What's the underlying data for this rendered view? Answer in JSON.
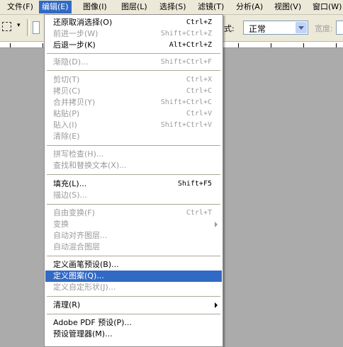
{
  "menubar": {
    "items": [
      {
        "label": "文件(F)"
      },
      {
        "label": "编辑(E)"
      },
      {
        "label": "图像(I)"
      },
      {
        "label": "图层(L)"
      },
      {
        "label": "选择(S)"
      },
      {
        "label": "滤镜(T)"
      },
      {
        "label": "分析(A)"
      },
      {
        "label": "视图(V)"
      },
      {
        "label": "窗口(W)"
      }
    ],
    "active_index": 1
  },
  "options_bar": {
    "style_label": "式:",
    "mode_value": "正常",
    "width_label": "宽度:"
  },
  "edit_menu": {
    "items": [
      {
        "label": "还原取消选择(O)",
        "shortcut": "Ctrl+Z",
        "enabled": true
      },
      {
        "label": "前进一步(W)",
        "shortcut": "Shift+Ctrl+Z",
        "enabled": false
      },
      {
        "label": "后退一步(K)",
        "shortcut": "Alt+Ctrl+Z",
        "enabled": true
      },
      {
        "label": "渐隐(D)...",
        "shortcut": "Shift+Ctrl+F",
        "enabled": false
      },
      {
        "label": "剪切(T)",
        "shortcut": "Ctrl+X",
        "enabled": false
      },
      {
        "label": "拷贝(C)",
        "shortcut": "Ctrl+C",
        "enabled": false
      },
      {
        "label": "合并拷贝(Y)",
        "shortcut": "Shift+Ctrl+C",
        "enabled": false
      },
      {
        "label": "粘贴(P)",
        "shortcut": "Ctrl+V",
        "enabled": false
      },
      {
        "label": "贴入(I)",
        "shortcut": "Shift+Ctrl+V",
        "enabled": false
      },
      {
        "label": "清除(E)",
        "shortcut": "",
        "enabled": false
      },
      {
        "label": "拼写检查(H)...",
        "shortcut": "",
        "enabled": false
      },
      {
        "label": "查找和替换文本(X)...",
        "shortcut": "",
        "enabled": false
      },
      {
        "label": "填充(L)...",
        "shortcut": "Shift+F5",
        "enabled": true
      },
      {
        "label": "描边(S)...",
        "shortcut": "",
        "enabled": false
      },
      {
        "label": "自由变换(F)",
        "shortcut": "Ctrl+T",
        "enabled": false
      },
      {
        "label": "变换",
        "shortcut": "",
        "enabled": false,
        "submenu": true
      },
      {
        "label": "自动对齐图层...",
        "shortcut": "",
        "enabled": false
      },
      {
        "label": "自动混合图层",
        "shortcut": "",
        "enabled": false
      },
      {
        "label": "定义画笔预设(B)...",
        "shortcut": "",
        "enabled": true
      },
      {
        "label": "定义图案(Q)...",
        "shortcut": "",
        "enabled": true,
        "highlighted": true
      },
      {
        "label": "定义自定形状(J)...",
        "shortcut": "",
        "enabled": false
      },
      {
        "label": "清理(R)",
        "shortcut": "",
        "enabled": true,
        "submenu": true
      },
      {
        "label": "Adobe PDF 预设(P)...",
        "shortcut": "",
        "enabled": true
      },
      {
        "label": "预设管理器(M)...",
        "shortcut": "",
        "enabled": true
      }
    ]
  }
}
